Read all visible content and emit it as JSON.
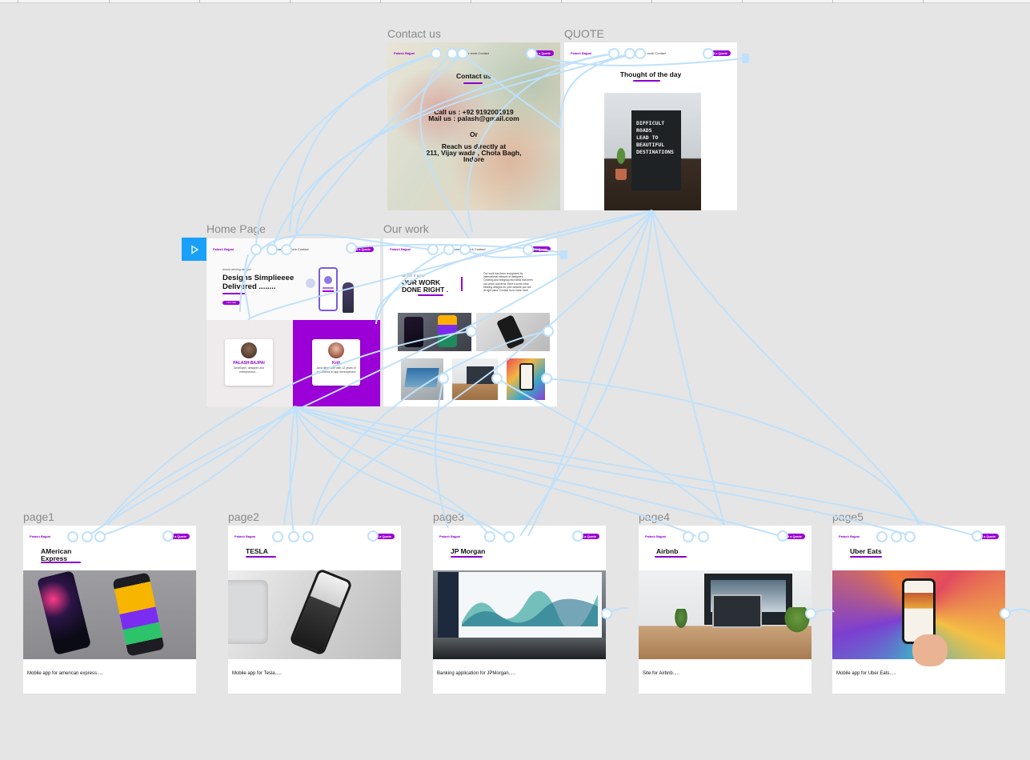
{
  "canvas": {
    "background": "#e5e5e5",
    "link_color": "#bfe1fb",
    "accent": "#9b00d6"
  },
  "frames": {
    "contact": {
      "label": "Contact us",
      "nav": {
        "logo": "Palash Bajpai",
        "links": "Home   Our work   Contact",
        "button": "Get a Quote"
      },
      "heading": "Contact us",
      "phone": "Call us : +92 9192001919",
      "mail": "Mail us : palash@gmail.com",
      "or": "Or",
      "reach": "Reach us directly at",
      "address_1": "211, Vijay wada , Chota Bagh,",
      "address_2": "Indore"
    },
    "quote": {
      "label": "QUOTE",
      "nav": {
        "logo": "Palash Bajpai",
        "links": "Home   Our work   Contact",
        "button": "Get a Quote"
      },
      "heading": "Thought of the day",
      "board_text": "DIFFICULT\nROADS\nLEAD TO\nBEAUTIFUL\nDESTINATIONS"
    },
    "home": {
      "label": "Home Page",
      "nav": {
        "logo": "Palash Bajpai",
        "links": "Home   Our work   Contact",
        "button": "Get a Quote"
      },
      "small": "Award winning designs",
      "heading": "Designs Simplieeee\nDelivered ........",
      "cta": "Let's talk",
      "card_1": {
        "name": "PALASH BAJPAI",
        "desc": "Developer, designer and entrepreneur...."
      },
      "card_2": {
        "name": "Kriti",
        "desc": "Java developer with 12 years of experience in app development"
      }
    },
    "work": {
      "label": "Our work",
      "nav": {
        "logo": "Palash Bajpai",
        "links": "Home   Our work   Contact",
        "button": "Get a Quote"
      },
      "small": "WE GET IT DONE",
      "heading": "OUR WORK\nDONE RIGHT .",
      "desc": "Our work has been recognised by international network of designers. Creating and bringing new ideas has been our prime concerns. Here's some mind blowing designs for your website you are at right place Contact us to know more"
    },
    "page1": {
      "label": "page1",
      "title": "AMerican\nExpress",
      "desc": "Mobile app for american express....."
    },
    "page2": {
      "label": "page2",
      "title": "TESLA",
      "desc": "Mobile app for Tesla....."
    },
    "page3": {
      "label": "page3",
      "title": "JP Morgan",
      "desc": "Banking application for JPMorgan....."
    },
    "page4": {
      "label": "page4",
      "title": "Airbnb",
      "desc": "Site for Airbnb....."
    },
    "page5": {
      "label": "page5",
      "title": "Uber Eats",
      "desc": "Mobile app for Uber Eats....."
    }
  },
  "icons": {
    "play": "play-icon"
  }
}
